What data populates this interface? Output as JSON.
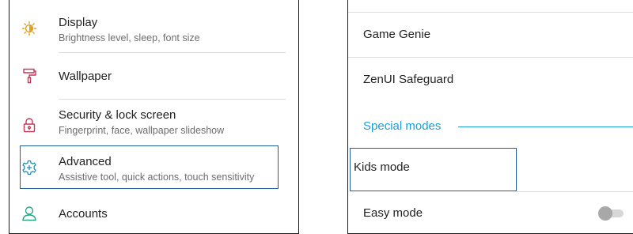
{
  "left_panel": {
    "items": [
      {
        "title": "Display",
        "subtitle": "Brightness level, sleep, font size",
        "icon": "display-brightness-icon"
      },
      {
        "title": "Wallpaper",
        "subtitle": "",
        "icon": "paint-roller-icon"
      },
      {
        "title": "Security & lock screen",
        "subtitle": "Fingerprint, face, wallpaper slideshow",
        "icon": "lock-icon"
      },
      {
        "title": "Advanced",
        "subtitle": "Assistive tool, quick actions, touch sensitivity",
        "icon": "gear-plus-icon",
        "highlighted": true
      },
      {
        "title": "Accounts",
        "subtitle": "",
        "icon": "person-icon"
      }
    ]
  },
  "right_panel": {
    "items": [
      {
        "title": "Game Genie"
      },
      {
        "title": "ZenUI Safeguard"
      }
    ],
    "section_header": "Special modes",
    "special_modes": [
      {
        "title": "Kids mode",
        "highlighted": true
      },
      {
        "title": "Easy mode",
        "toggle": "off"
      }
    ]
  },
  "colors": {
    "accent": "#1aa0d8",
    "icon_tint": "#e0a020",
    "icon_teal": "#2aa58a",
    "icon_rose": "#c23a5a",
    "highlight_border": "#1e5f99"
  }
}
